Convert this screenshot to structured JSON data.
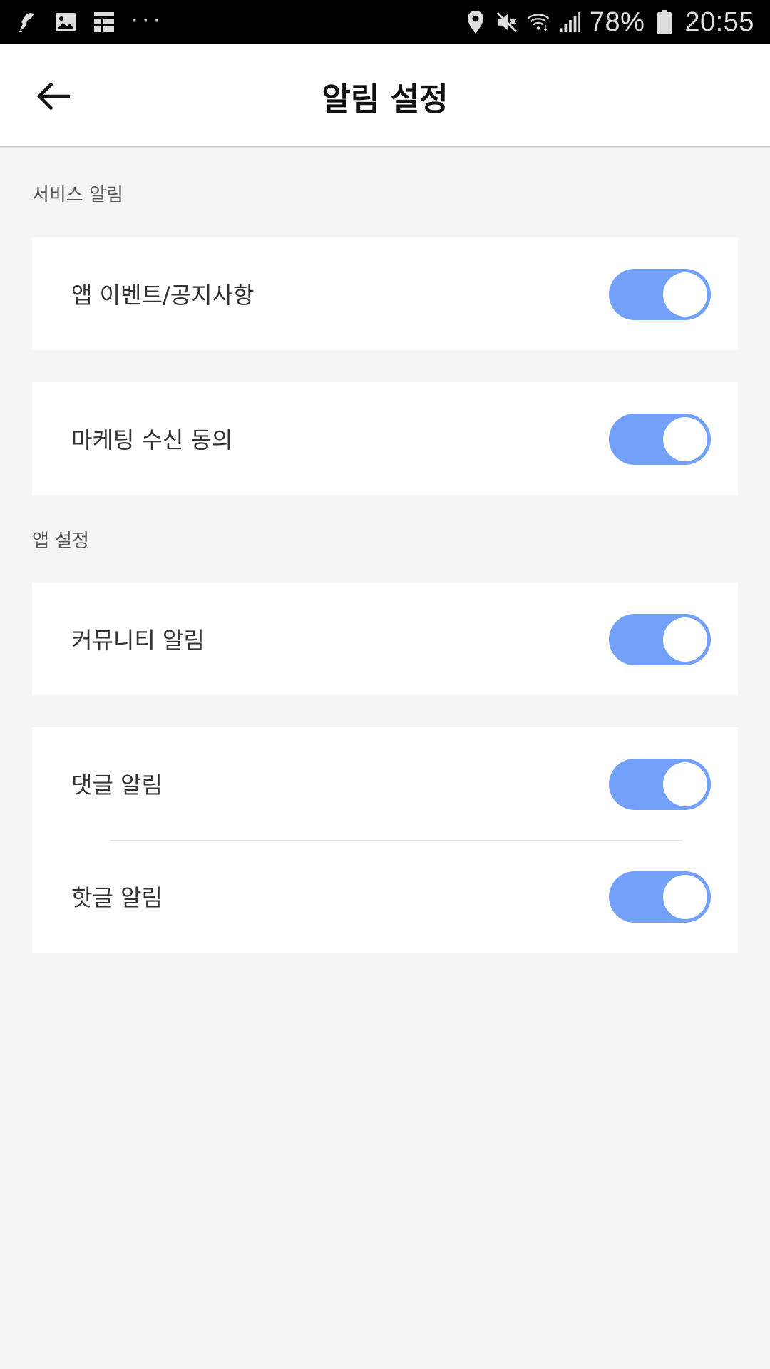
{
  "status_bar": {
    "battery_percent": "78%",
    "time": "20:55",
    "dots": "···",
    "icons": [
      "app-notification-icon",
      "image-icon",
      "calendar-icon",
      "more-icon",
      "location-icon",
      "mute-icon",
      "wifi-icon",
      "signal-icon",
      "battery-icon"
    ]
  },
  "header": {
    "title": "알림 설정",
    "back_icon": "arrow-left-icon"
  },
  "sections": {
    "service": {
      "label": "서비스 알림",
      "items": [
        {
          "label": "앱 이벤트/공지사항",
          "enabled": true
        },
        {
          "label": "마케팅 수신 동의",
          "enabled": true
        }
      ]
    },
    "app": {
      "label": "앱 설정",
      "items": [
        {
          "label": "커뮤니티 알림",
          "enabled": true
        },
        {
          "label": "댓글 알림",
          "enabled": true
        },
        {
          "label": "핫글 알림",
          "enabled": true
        }
      ]
    }
  },
  "colors": {
    "toggle_on": "#73a0f8",
    "background": "#f5f5f5",
    "card": "#ffffff"
  }
}
